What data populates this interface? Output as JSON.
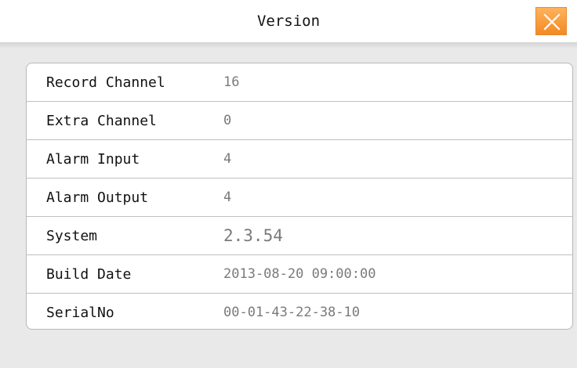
{
  "window": {
    "title": "Version",
    "close_icon": "close-icon"
  },
  "rows": [
    {
      "label": "Record Channel",
      "value": "16"
    },
    {
      "label": "Extra Channel",
      "value": "0"
    },
    {
      "label": "Alarm Input",
      "value": "4"
    },
    {
      "label": "Alarm Output",
      "value": "4"
    },
    {
      "label": "System",
      "value": "2.3.54"
    },
    {
      "label": "Build Date",
      "value": "2013-08-20 09:00:00"
    },
    {
      "label": "SerialNo",
      "value": "00-01-43-22-38-10"
    }
  ],
  "colors": {
    "accent": "#f28a24",
    "background": "#e9e9e9",
    "panel": "#ffffff",
    "value_text": "#7a7a7a"
  }
}
